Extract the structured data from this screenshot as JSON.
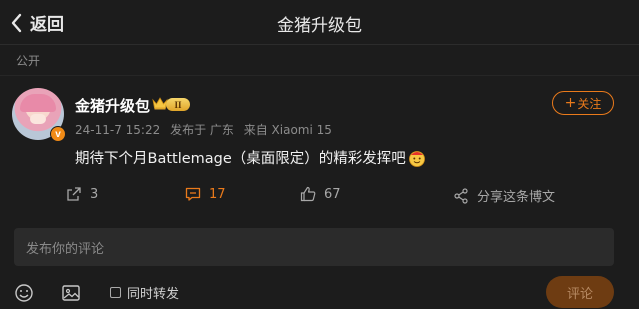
{
  "header": {
    "back_label": "返回",
    "title": "金猪升级包"
  },
  "visibility": "公开",
  "post": {
    "username": "金猪升级包",
    "level_badge": "II",
    "verified_mark": "v",
    "follow_label": "关注",
    "follow_plus": "+",
    "meta": {
      "time": "24-11-7 15:22",
      "published_from": "发布于 广东",
      "device": "来自 Xiaomi 15"
    },
    "content": "期待下个月Battlemage（桌面限定）的精彩发挥吧",
    "content_emoji": "fortune-smiley-emoji"
  },
  "actions": {
    "repost_count": "3",
    "comment_count": "17",
    "like_count": "67",
    "share_label": "分享这条博文"
  },
  "composer": {
    "placeholder": "发布你的评论",
    "repost_label": "同时转发",
    "submit_label": "评论",
    "repost_checked": false
  },
  "colors": {
    "background": "#1c1c1c",
    "accent": "#ea7a1b",
    "submit_disabled": "#6e3c12",
    "input_bg": "#2b2b2b"
  }
}
